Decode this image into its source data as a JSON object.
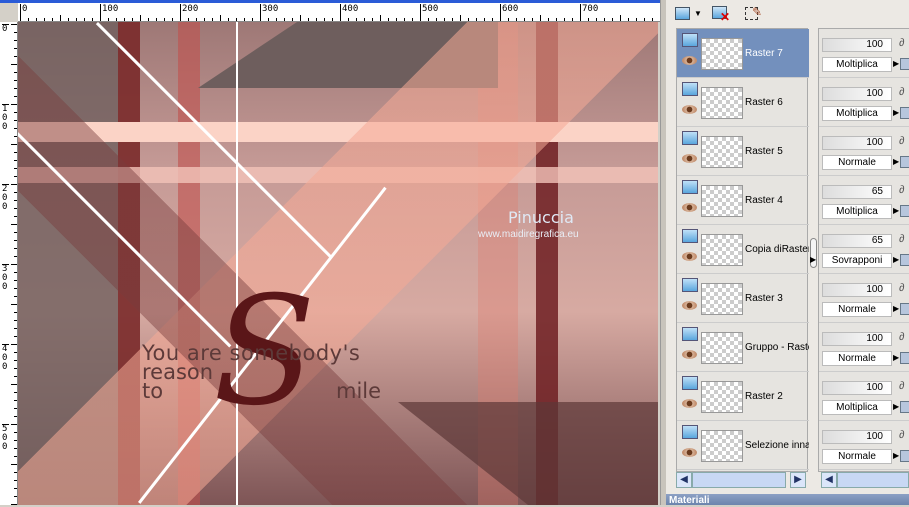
{
  "rulers": {
    "horizontal": [
      "0",
      "100",
      "200",
      "300",
      "400",
      "500",
      "600",
      "700"
    ],
    "vertical": [
      "0",
      "100",
      "200",
      "300",
      "400",
      "500"
    ]
  },
  "canvas": {
    "watermark_name": "Pinuccia",
    "watermark_url": "www.maidiregrafica.eu",
    "text_line1": "You are somebody's",
    "text_line2": "reason",
    "text_line3": "to",
    "text_line4": "mile",
    "script_letter": "S"
  },
  "toolbar": {
    "icons": [
      "new-layer-icon",
      "delete-layer-icon",
      "edit-selection-icon"
    ]
  },
  "layers": [
    {
      "name": "Raster 7",
      "opacity": "100",
      "blend": "Moltiplica",
      "selected": true
    },
    {
      "name": "Raster 6",
      "opacity": "100",
      "blend": "Moltiplica"
    },
    {
      "name": "Raster 5",
      "opacity": "100",
      "blend": "Normale"
    },
    {
      "name": "Raster 4",
      "opacity": "65",
      "blend": "Moltiplica"
    },
    {
      "name": "Copia diRaster",
      "opacity": "65",
      "blend": "Sovrapponi"
    },
    {
      "name": "Raster 3",
      "opacity": "100",
      "blend": "Normale"
    },
    {
      "name": "Gruppo - Raster",
      "opacity": "100",
      "blend": "Normale"
    },
    {
      "name": "Raster 2",
      "opacity": "100",
      "blend": "Moltiplica"
    },
    {
      "name": "Selezione innalzata",
      "opacity": "100",
      "blend": "Normale"
    }
  ],
  "materials_title": "Materiali",
  "colors": {
    "selected_row": "#7390bd",
    "accent_red": "#8b2a2a",
    "pink_band": "#fbd3c6"
  }
}
